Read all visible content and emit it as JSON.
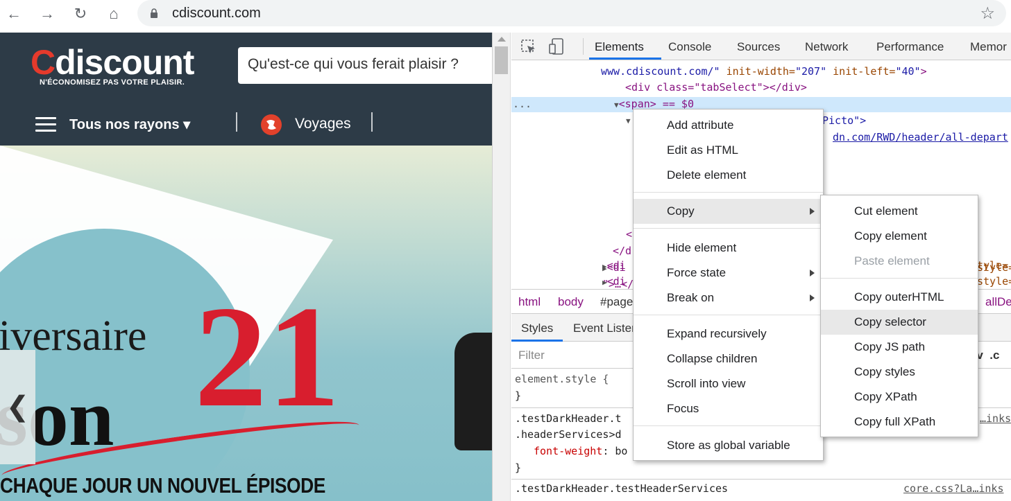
{
  "browser": {
    "url": "cdiscount.com",
    "back_icon": "←",
    "forward_icon": "→",
    "reload_icon": "↻",
    "home_icon": "⌂",
    "star_icon": "☆"
  },
  "site": {
    "logo_c": "C",
    "logo_rest": "discount",
    "tagline": "N'ÉCONOMISEZ PAS VOTRE PLAISIR.",
    "search_placeholder": "Qu'est-ce qui vous ferait plaisir ?",
    "nav_rayons": "Tous nos rayons ▾",
    "nav_voyages": "Voyages",
    "banner_versaire": "iversaire",
    "banner_son": "son",
    "banner_21": "21",
    "banner_episode": "CHAQUE JOUR UN NOUVEL ÉPISODE",
    "prev_arrow": "❮",
    "colors": {
      "header": "#2d3b47",
      "brand_red": "#e53a2c"
    }
  },
  "devtools": {
    "tabs": [
      "Elements",
      "Console",
      "Sources",
      "Network",
      "Performance",
      "Memor"
    ],
    "elements_lines": {
      "l1_text": "www.cdiscount.com/\"",
      "l1_attr1": " init-width=",
      "l1_val1": "\"207\"",
      "l1_attr2": " init-left=",
      "l1_val2": "\"40\"",
      "l1_end": ">",
      "l2": "<div class=\"tabSelect\"></div>",
      "l3": "<span> == $0",
      "l3_dots": "...",
      "l4": "Picto\">",
      "l5": "dn.com/RWD/header/all-depart",
      "l6": "<",
      "l7": "</d",
      "l8": "<di",
      "l8_right": "style=",
      "l9": "\">…</",
      "l10": "<di",
      "l10_right": "tyle=",
      "l11": "<di",
      "l11_right": "style="
    },
    "breadcrumbs": [
      "html",
      "body",
      "#page",
      "allDep"
    ],
    "styles_tabs": [
      "Styles",
      "Event Listen"
    ],
    "styles_right": "ov  .c",
    "filter_placeholder": "Filter",
    "styles": {
      "s1": "element.style {",
      "s2": "}",
      "s3": ".testDarkHeader.t",
      "s3_right": "…inks",
      "s4": ".headerServices>d",
      "s5_prop": "font-weight",
      "s5_val": ": bo",
      "s6": "}",
      "s7": ".testDarkHeader.testHeaderServices",
      "s7_right": "core.css?La…inks"
    }
  },
  "context_menu": {
    "items": [
      {
        "label": "Add attribute",
        "arrow": false
      },
      {
        "label": "Edit as HTML",
        "arrow": false
      },
      {
        "label": "Delete element",
        "arrow": false
      },
      {
        "label": "Copy",
        "arrow": true
      },
      {
        "label": "Hide element",
        "arrow": false
      },
      {
        "label": "Force state",
        "arrow": true
      },
      {
        "label": "Break on",
        "arrow": true
      },
      {
        "label": "Expand recursively",
        "arrow": false
      },
      {
        "label": "Collapse children",
        "arrow": false
      },
      {
        "label": "Scroll into view",
        "arrow": false
      },
      {
        "label": "Focus",
        "arrow": false
      },
      {
        "label": "Store as global variable",
        "arrow": false
      }
    ],
    "highlighted": "Copy"
  },
  "copy_submenu": {
    "items": [
      {
        "label": "Cut element",
        "disabled": false
      },
      {
        "label": "Copy element",
        "disabled": false
      },
      {
        "label": "Paste element",
        "disabled": true
      },
      {
        "label": "Copy outerHTML",
        "disabled": false
      },
      {
        "label": "Copy selector",
        "disabled": false
      },
      {
        "label": "Copy JS path",
        "disabled": false
      },
      {
        "label": "Copy styles",
        "disabled": false
      },
      {
        "label": "Copy XPath",
        "disabled": false
      },
      {
        "label": "Copy full XPath",
        "disabled": false
      }
    ],
    "highlighted": "Copy selector"
  }
}
